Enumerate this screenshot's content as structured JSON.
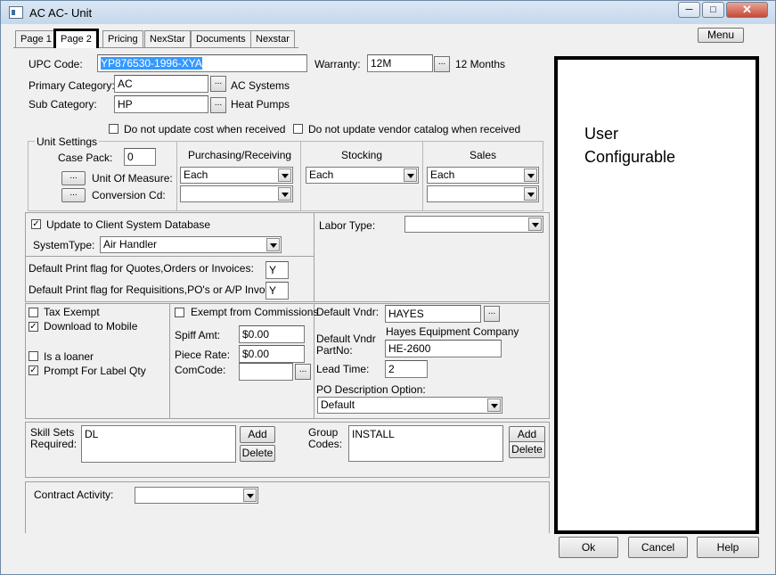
{
  "window": {
    "title": "AC  AC- Unit",
    "minimize": "─",
    "maximize": "□",
    "close": "✕"
  },
  "tabs": [
    "Page 1",
    "Page 2",
    "Pricing",
    "NexStar",
    "Documents",
    "Nexstar"
  ],
  "menu_label": "Menu",
  "upc": {
    "label": "UPC Code:",
    "value": "YP876530-1996-XYA"
  },
  "warranty": {
    "label": "Warranty:",
    "value": "12M",
    "desc": "12 Months"
  },
  "primary_category": {
    "label": "Primary Category:",
    "value": "AC",
    "desc": "AC Systems"
  },
  "sub_category": {
    "label": "Sub Category:",
    "value": "HP",
    "desc": "Heat Pumps"
  },
  "ellipsis": "...",
  "no_update_cost": "Do not update cost when received",
  "no_update_vendor": "Do not update vendor catalog when received",
  "unit_settings": {
    "title": "Unit Settings",
    "case_pack_label": "Case Pack:",
    "case_pack_value": "0",
    "uom_label": "Unit Of Measure:",
    "conversion_label": "Conversion Cd:",
    "purchasing_header": "Purchasing/Receiving",
    "stocking_header": "Stocking",
    "sales_header": "Sales",
    "purchasing_uom": "Each",
    "stocking_uom": "Each",
    "sales_uom": "Each"
  },
  "client_db": {
    "update_label": "Update to Client System Database",
    "system_type_label": "SystemType:",
    "system_type_value": "Air Handler",
    "print_quotes_label": "Default Print flag for Quotes,Orders or Invoices:",
    "print_quotes_value": "Y",
    "print_req_label": "Default Print flag for Requisitions,PO's or A/P Invoices:",
    "print_req_value": "Y"
  },
  "labor_type_label": "Labor Type:",
  "flags": {
    "tax_exempt": "Tax Exempt",
    "download_mobile": "Download to Mobile",
    "is_loaner": "Is a loaner",
    "prompt_label_qty": "Prompt For Label Qty",
    "check": "✓"
  },
  "commission": {
    "exempt_label": "Exempt from Commissions",
    "spiff_label": "Spiff Amt:",
    "spiff_value": "$0.00",
    "piece_label": "Piece Rate:",
    "piece_value": "$0.00",
    "comcode_label": "ComCode:"
  },
  "vendor": {
    "default_vndr_label": "Default Vndr:",
    "default_vndr_value": "HAYES",
    "vendor_name": "Hayes Equipment Company",
    "partno_label_1": "Default Vndr",
    "partno_label_2": "PartNo:",
    "partno_value": "HE-2600",
    "lead_time_label": "Lead Time:",
    "lead_time_value": "2",
    "po_desc_label": "PO Description Option:",
    "po_desc_value": "Default"
  },
  "skills": {
    "label_1": "Skill Sets",
    "label_2": "Required:",
    "value": "DL",
    "add": "Add",
    "delete": "Delete"
  },
  "groups": {
    "label_1": "Group",
    "label_2": "Codes:",
    "value": "INSTALL",
    "add": "Add",
    "delete": "Delete"
  },
  "contract_activity_label": "Contract Activity:",
  "user_configurable": "User\nConfigurable",
  "footer": {
    "ok": "Ok",
    "cancel": "Cancel",
    "help": "Help"
  }
}
